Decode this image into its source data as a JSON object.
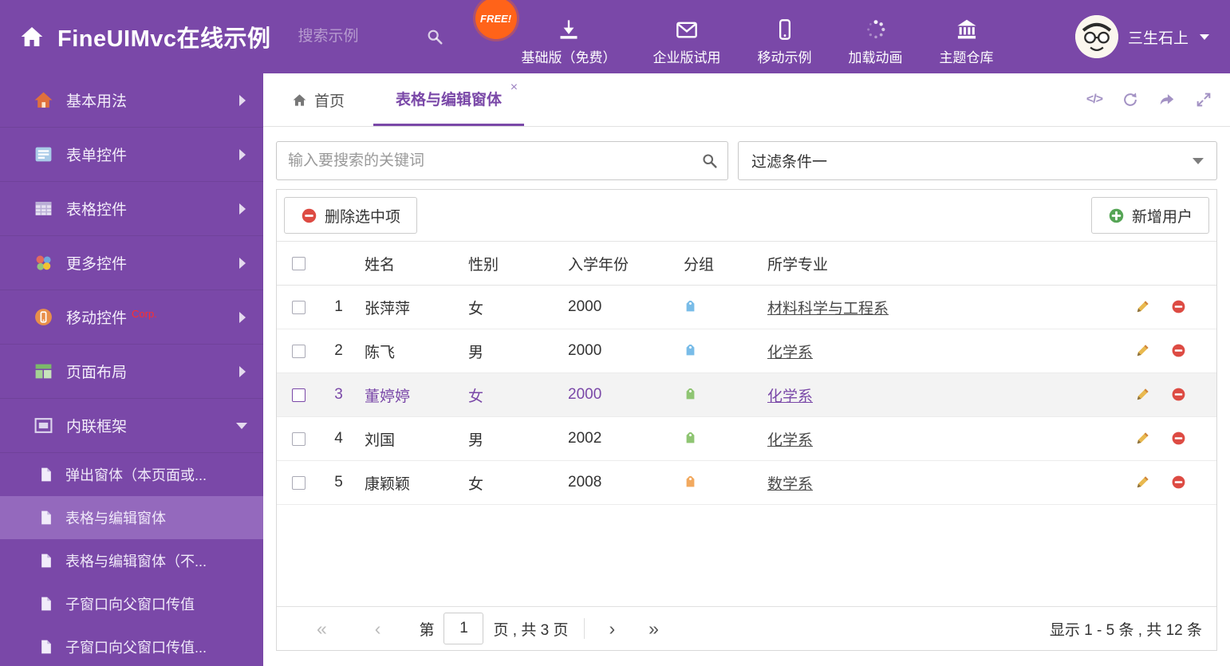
{
  "header": {
    "title": "FineUIMvc在线示例",
    "search_placeholder": "搜索示例",
    "free_badge": "FREE!",
    "nav": [
      {
        "label": "基础版（免费）",
        "icon": "download-icon"
      },
      {
        "label": "企业版试用",
        "icon": "envelope-icon"
      },
      {
        "label": "移动示例",
        "icon": "mobile-icon"
      },
      {
        "label": "加载动画",
        "icon": "spinner-icon"
      },
      {
        "label": "主题仓库",
        "icon": "bank-icon"
      }
    ],
    "username": "三生石上"
  },
  "sidebar": {
    "items": [
      {
        "label": "基本用法",
        "icon": "house-icon"
      },
      {
        "label": "表单控件",
        "icon": "form-icon"
      },
      {
        "label": "表格控件",
        "icon": "table-icon"
      },
      {
        "label": "更多控件",
        "icon": "widgets-icon"
      },
      {
        "label": "移动控件",
        "icon": "mobile-circle-icon",
        "badge": "Corp."
      },
      {
        "label": "页面布局",
        "icon": "layout-icon"
      },
      {
        "label": "内联框架",
        "icon": "frame-icon"
      }
    ],
    "subitems": [
      {
        "label": "弹出窗体（本页面或..."
      },
      {
        "label": "表格与编辑窗体"
      },
      {
        "label": "表格与编辑窗体（不..."
      },
      {
        "label": "子窗口向父窗口传值"
      },
      {
        "label": "子窗口向父窗口传值..."
      }
    ]
  },
  "tabs": {
    "home_label": "首页",
    "active_label": "表格与编辑窗体"
  },
  "filterbar": {
    "keyword_placeholder": "输入要搜索的关键词",
    "filter_selected": "过滤条件一"
  },
  "toolbar": {
    "delete_button": "删除选中项",
    "add_button": "新增用户"
  },
  "table": {
    "headers": {
      "name": "姓名",
      "gender": "性别",
      "year": "入学年份",
      "group": "分组",
      "major": "所学专业"
    },
    "rows": [
      {
        "index": "1",
        "name": "张萍萍",
        "gender": "女",
        "year": "2000",
        "tag_color": "#79bce8",
        "major": "材料科学与工程系",
        "selected": false
      },
      {
        "index": "2",
        "name": "陈飞",
        "gender": "男",
        "year": "2000",
        "tag_color": "#79bce8",
        "major": "化学系",
        "selected": false
      },
      {
        "index": "3",
        "name": "董婷婷",
        "gender": "女",
        "year": "2000",
        "tag_color": "#8fc573",
        "major": "化学系",
        "selected": true
      },
      {
        "index": "4",
        "name": "刘国",
        "gender": "男",
        "year": "2002",
        "tag_color": "#8fc573",
        "major": "化学系",
        "selected": false
      },
      {
        "index": "5",
        "name": "康颖颖",
        "gender": "女",
        "year": "2008",
        "tag_color": "#f2a95f",
        "major": "数学系",
        "selected": false
      }
    ]
  },
  "pagination": {
    "page_prefix": "第",
    "page_value": "1",
    "page_suffix": "页 , 共 3 页",
    "summary": "显示 1 - 5 条 , 共 12 条"
  },
  "icons": {
    "code": "</>",
    "close_tab": "×",
    "first_page": "«",
    "prev_page": "‹",
    "next_page": "›",
    "last_page": "»"
  },
  "colors": {
    "theme_purple": "#7a48a8",
    "sidebar_selected": "#9469bd",
    "free_badge": "#ff6319",
    "delete_red": "#dd4b43",
    "add_green": "#56a556",
    "corp_badge": "#ff2d2d"
  }
}
